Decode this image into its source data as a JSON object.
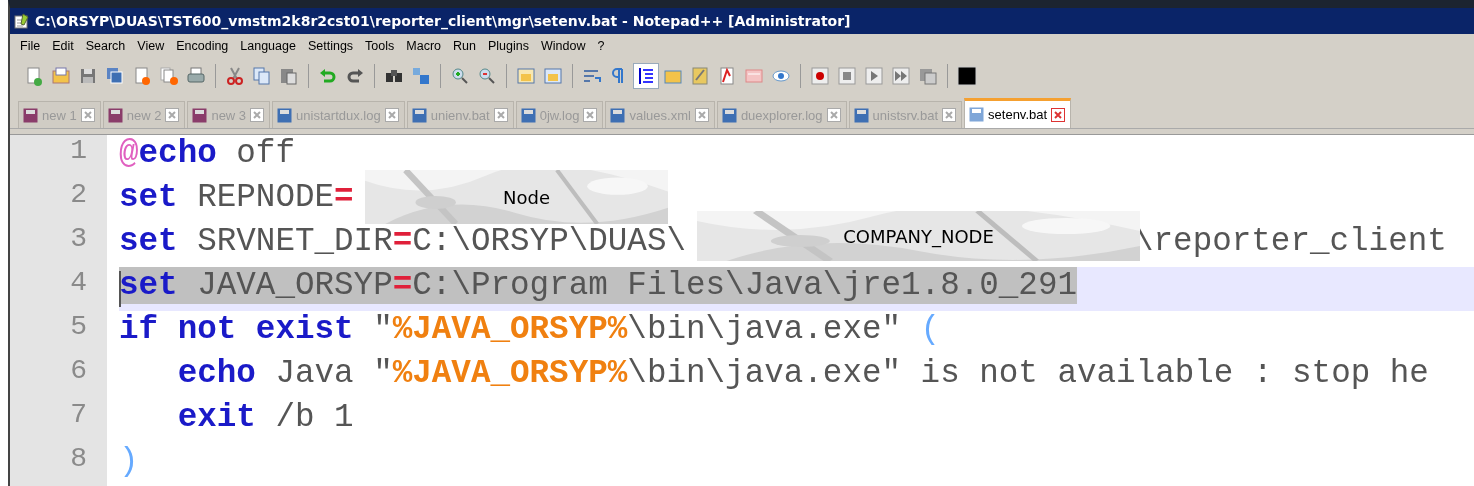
{
  "window": {
    "title": "C:\\ORSYP\\DUAS\\TST600_vmstm2k8r2cst01\\reporter_client\\mgr\\setenv.bat - Notepad++ [Administrator]"
  },
  "menu": [
    "File",
    "Edit",
    "Search",
    "View",
    "Encoding",
    "Language",
    "Settings",
    "Tools",
    "Macro",
    "Run",
    "Plugins",
    "Window",
    "?"
  ],
  "toolbar": [
    {
      "kind": "new",
      "selected": false
    },
    {
      "kind": "open",
      "selected": false
    },
    {
      "kind": "save",
      "selected": false
    },
    {
      "kind": "saveall",
      "selected": false
    },
    {
      "kind": "close",
      "selected": false
    },
    {
      "kind": "closeall",
      "selected": false
    },
    {
      "kind": "print",
      "selected": false
    },
    {
      "kind": "sep"
    },
    {
      "kind": "cut",
      "selected": false
    },
    {
      "kind": "copy",
      "selected": false
    },
    {
      "kind": "paste",
      "selected": false
    },
    {
      "kind": "sep"
    },
    {
      "kind": "undo",
      "selected": false
    },
    {
      "kind": "redo",
      "selected": false
    },
    {
      "kind": "sep"
    },
    {
      "kind": "find",
      "selected": false
    },
    {
      "kind": "replace",
      "selected": false
    },
    {
      "kind": "sep"
    },
    {
      "kind": "zoomin",
      "selected": false
    },
    {
      "kind": "zoomout",
      "selected": false
    },
    {
      "kind": "sep"
    },
    {
      "kind": "syncv",
      "selected": false
    },
    {
      "kind": "synch",
      "selected": false
    },
    {
      "kind": "sep"
    },
    {
      "kind": "wrap",
      "selected": false
    },
    {
      "kind": "pilcrow",
      "selected": false
    },
    {
      "kind": "indent",
      "selected": true
    },
    {
      "kind": "folder",
      "selected": false
    },
    {
      "kind": "docmap",
      "selected": false
    },
    {
      "kind": "funclist",
      "selected": false
    },
    {
      "kind": "panel",
      "selected": false
    },
    {
      "kind": "eye",
      "selected": false
    },
    {
      "kind": "sep"
    },
    {
      "kind": "record",
      "selected": false
    },
    {
      "kind": "stop",
      "selected": false
    },
    {
      "kind": "play",
      "selected": false
    },
    {
      "kind": "playmulti",
      "selected": false
    },
    {
      "kind": "savemacro",
      "selected": false
    },
    {
      "kind": "sep"
    },
    {
      "kind": "swatch",
      "selected": false
    }
  ],
  "tabs": [
    {
      "label": "new 1",
      "saved": false,
      "selected": false
    },
    {
      "label": "new 2",
      "saved": false,
      "selected": false
    },
    {
      "label": "new 3",
      "saved": false,
      "selected": false
    },
    {
      "label": "unistartdux.log",
      "saved": true,
      "selected": false
    },
    {
      "label": "unienv.bat",
      "saved": true,
      "selected": false
    },
    {
      "label": "0jw.log",
      "saved": true,
      "selected": false
    },
    {
      "label": "values.xml",
      "saved": true,
      "selected": false
    },
    {
      "label": "duexplorer.log",
      "saved": true,
      "selected": false
    },
    {
      "label": "unistsrv.bat",
      "saved": true,
      "selected": false
    },
    {
      "label": "setenv.bat",
      "saved": true,
      "selected": true
    }
  ],
  "editor": {
    "lines": [
      {
        "number": "1",
        "current": false,
        "selected": false,
        "tokens": [
          {
            "kind": "at",
            "text": "@"
          },
          {
            "kind": "keyword",
            "text": "echo"
          },
          {
            "kind": "text",
            "text": " off"
          }
        ]
      },
      {
        "number": "2",
        "current": false,
        "selected": false,
        "tokens": [
          {
            "kind": "keyword",
            "text": "set"
          },
          {
            "kind": "text",
            "text": " REPNODE"
          },
          {
            "kind": "operator",
            "text": "="
          }
        ]
      },
      {
        "number": "3",
        "current": false,
        "selected": false,
        "tokens": [
          {
            "kind": "keyword",
            "text": "set"
          },
          {
            "kind": "text",
            "text": " SRVNET_DIR"
          },
          {
            "kind": "operator",
            "text": "="
          },
          {
            "kind": "text",
            "text": "C:\\ORSYP\\DUAS\\"
          },
          {
            "kind": "gap"
          },
          {
            "kind": "text",
            "text": "\\reporter_client"
          }
        ]
      },
      {
        "number": "4",
        "current": true,
        "selected": true,
        "tokens": [
          {
            "kind": "keyword",
            "text": "set"
          },
          {
            "kind": "text",
            "text": " JAVA_ORSYP"
          },
          {
            "kind": "operator",
            "text": "="
          },
          {
            "kind": "text",
            "text": "C:\\Program Files\\Java\\jre1.8.0_291"
          }
        ]
      },
      {
        "number": "5",
        "current": false,
        "selected": false,
        "tokens": [
          {
            "kind": "keyword",
            "text": "if not exist"
          },
          {
            "kind": "text",
            "text": " \""
          },
          {
            "kind": "variable",
            "text": "%JAVA_ORSYP%"
          },
          {
            "kind": "text",
            "text": "\\bin\\java.exe\" "
          },
          {
            "kind": "bracket",
            "text": "("
          }
        ]
      },
      {
        "number": "6",
        "current": false,
        "selected": false,
        "tokens": [
          {
            "kind": "keyword",
            "text": "   echo"
          },
          {
            "kind": "text",
            "text": " Java \""
          },
          {
            "kind": "variable",
            "text": "%JAVA_ORSYP%"
          },
          {
            "kind": "text",
            "text": "\\bin\\java.exe\" is not available : stop he"
          }
        ]
      },
      {
        "number": "7",
        "current": false,
        "selected": false,
        "tokens": [
          {
            "kind": "keyword",
            "text": "   exit"
          },
          {
            "kind": "text",
            "text": " /b 1"
          }
        ]
      },
      {
        "number": "8",
        "current": false,
        "selected": false,
        "tokens": [
          {
            "kind": "bracket",
            "text": ")"
          }
        ]
      }
    ],
    "redactions": [
      {
        "label": "Node"
      },
      {
        "label": "COMPANY_NODE"
      }
    ]
  }
}
